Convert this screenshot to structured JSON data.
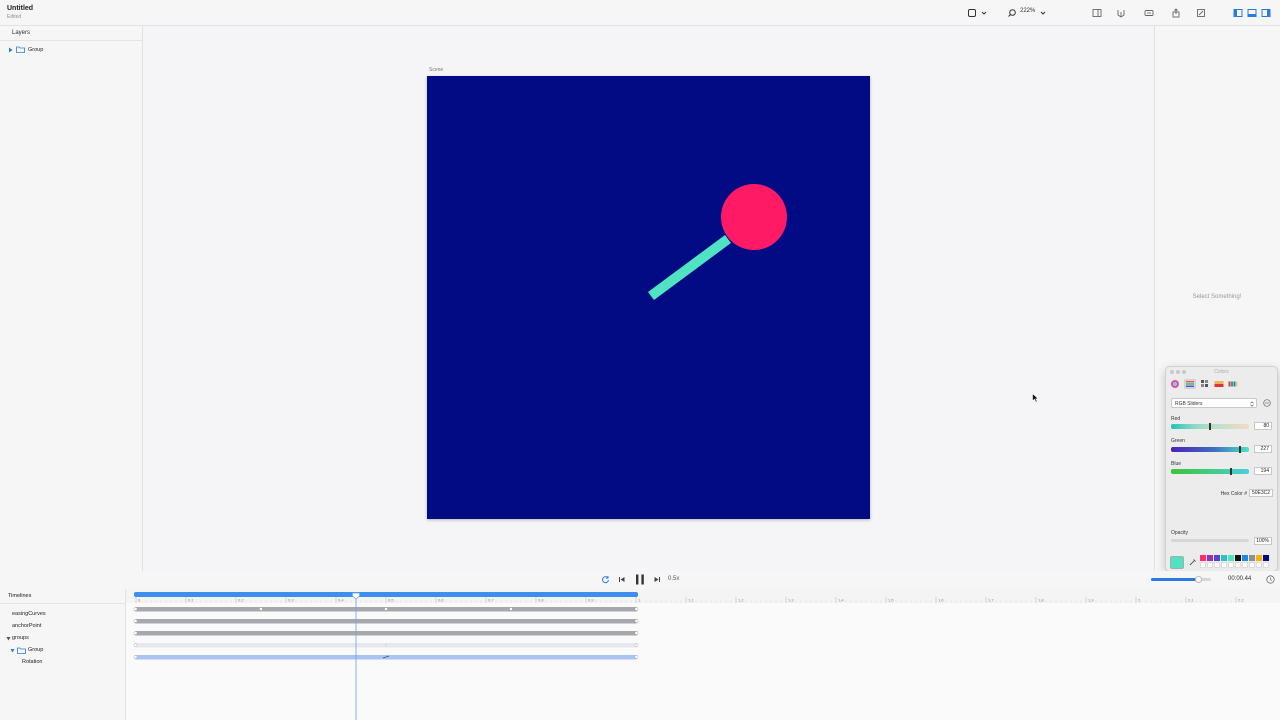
{
  "window": {
    "title": "Untitled",
    "status": "Edited"
  },
  "toolbar": {
    "shape_icon": "square-icon",
    "zoom_label": "222%",
    "right_icons": [
      "sidebar-left-icon",
      "component-icon",
      "keyboard-icon",
      "share-icon",
      "export-icon"
    ],
    "view_icons": [
      "toggle-layers-icon",
      "toggle-timeline-icon",
      "toggle-inspector-icon"
    ]
  },
  "layers": {
    "header": "Layers",
    "items": [
      {
        "label": "Group"
      }
    ]
  },
  "canvas": {
    "scene_label": "Scene",
    "scene_color": "#020b84",
    "stick_color": "#50e3c2",
    "ball_color": "#ff1a66"
  },
  "inspector": {
    "empty_message": "Select Something!"
  },
  "colors_panel": {
    "title": "Colors",
    "mode": "RGB Sliders",
    "red_label": "Red",
    "red_value": "80",
    "green_label": "Green",
    "green_value": "227",
    "blue_label": "Blue",
    "blue_value": "194",
    "hex_label": "Hex Color #",
    "hex_value": "50E3C2",
    "opacity_label": "Opacity",
    "opacity_value": "100%",
    "current_color": "#50e3c2",
    "swatches": [
      "#ff2d70",
      "#9b2fae",
      "#5d3fd3",
      "#2fc1c1",
      "#50e3c2",
      "#111111",
      "#1e88e5",
      "#8e8e93",
      "#ffb300",
      "#020b84"
    ]
  },
  "transport": {
    "speed": "0.5x",
    "time": "00:00.44",
    "volume_level": 0.8
  },
  "timeline": {
    "header": "Timelines",
    "tracks": [
      "easingCurves",
      "anchorPoint",
      "groups",
      "Group",
      "Rotation"
    ],
    "ruler_labels": [
      "0",
      "0.1",
      "0.2",
      "0.3",
      "0.4",
      "0.5",
      "0.6",
      "0.7",
      "0.8",
      "0.9",
      "1",
      "1.1",
      "1.2",
      "1.3",
      "1.4",
      "1.5",
      "1.6",
      "1.7",
      "1.8",
      "1.9",
      "2",
      "2.1",
      "2.2"
    ],
    "playhead_time": 0.44,
    "selection_end": 1
  }
}
